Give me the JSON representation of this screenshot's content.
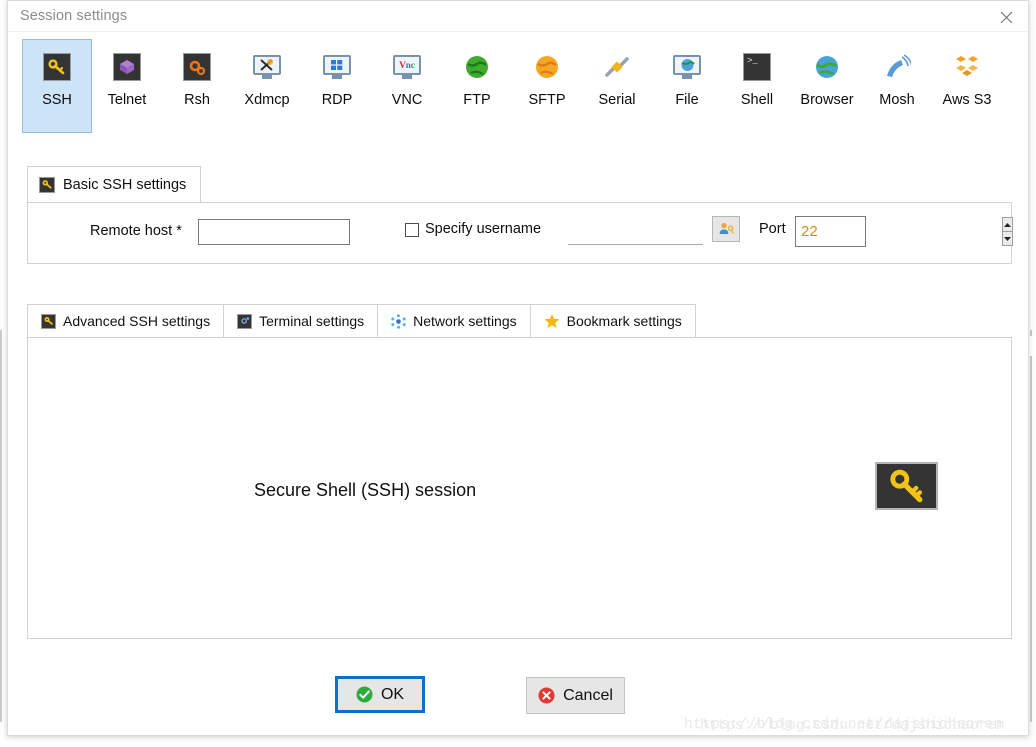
{
  "window": {
    "title": "Session settings",
    "close_icon": "close-icon"
  },
  "protocols": [
    {
      "label": "SSH",
      "icon": "ssh-key-icon",
      "selected": true
    },
    {
      "label": "Telnet",
      "icon": "telnet-cube-icon",
      "selected": false
    },
    {
      "label": "Rsh",
      "icon": "rsh-gears-icon",
      "selected": false
    },
    {
      "label": "Xdmcp",
      "icon": "xdmcp-monitor-icon",
      "selected": false
    },
    {
      "label": "RDP",
      "icon": "rdp-monitor-icon",
      "selected": false
    },
    {
      "label": "VNC",
      "icon": "vnc-monitor-icon",
      "selected": false
    },
    {
      "label": "FTP",
      "icon": "ftp-globe-icon",
      "selected": false
    },
    {
      "label": "SFTP",
      "icon": "sftp-globe-icon",
      "selected": false
    },
    {
      "label": "Serial",
      "icon": "serial-plug-icon",
      "selected": false
    },
    {
      "label": "File",
      "icon": "file-monitor-icon",
      "selected": false
    },
    {
      "label": "Shell",
      "icon": "shell-terminal-icon",
      "selected": false
    },
    {
      "label": "Browser",
      "icon": "browser-globe-icon",
      "selected": false
    },
    {
      "label": "Mosh",
      "icon": "mosh-dish-icon",
      "selected": false
    },
    {
      "label": "Aws S3",
      "icon": "aws-s3-cubes-icon",
      "selected": false
    }
  ],
  "basic_settings": {
    "tab_label": "Basic SSH settings",
    "tab_icon": "ssh-key-icon",
    "remote_host": {
      "label": "Remote host *",
      "value": "",
      "placeholder": ""
    },
    "specify_username": {
      "label": "Specify username",
      "checked": false,
      "value": "",
      "placeholder": "",
      "picker_icon": "user-key-icon"
    },
    "port": {
      "label": "Port",
      "value": "22",
      "value_color": "#e08a13",
      "up_icon": "chevron-up-icon",
      "down_icon": "chevron-down-icon"
    }
  },
  "lower_tabs": [
    {
      "label": "Advanced SSH settings",
      "icon": "ssh-key-icon",
      "active": true
    },
    {
      "label": "Terminal settings",
      "icon": "terminal-icon",
      "active": false
    },
    {
      "label": "Network settings",
      "icon": "network-dots-icon",
      "active": false
    },
    {
      "label": "Bookmark settings",
      "icon": "star-icon",
      "active": false
    }
  ],
  "session_panel": {
    "description": "Secure Shell (SSH) session",
    "icon": "ssh-key-icon"
  },
  "footer": {
    "ok": {
      "label": "OK",
      "icon": "check-circle-icon",
      "focused": true
    },
    "cancel": {
      "label": "Cancel",
      "icon": "x-circle-icon",
      "focused": false
    }
  },
  "watermark": {
    "line_a": "https://blog.csdn.net/dajshichaoren",
    "line_b": "https://blog.csdn.net/dajshichaoren"
  },
  "colors": {
    "selection_blue": "#cde4f7",
    "focus_blue": "#0a70c8",
    "accent_orange": "#e08a13",
    "ok_green": "#2eab3f",
    "cancel_red": "#e03a33"
  }
}
